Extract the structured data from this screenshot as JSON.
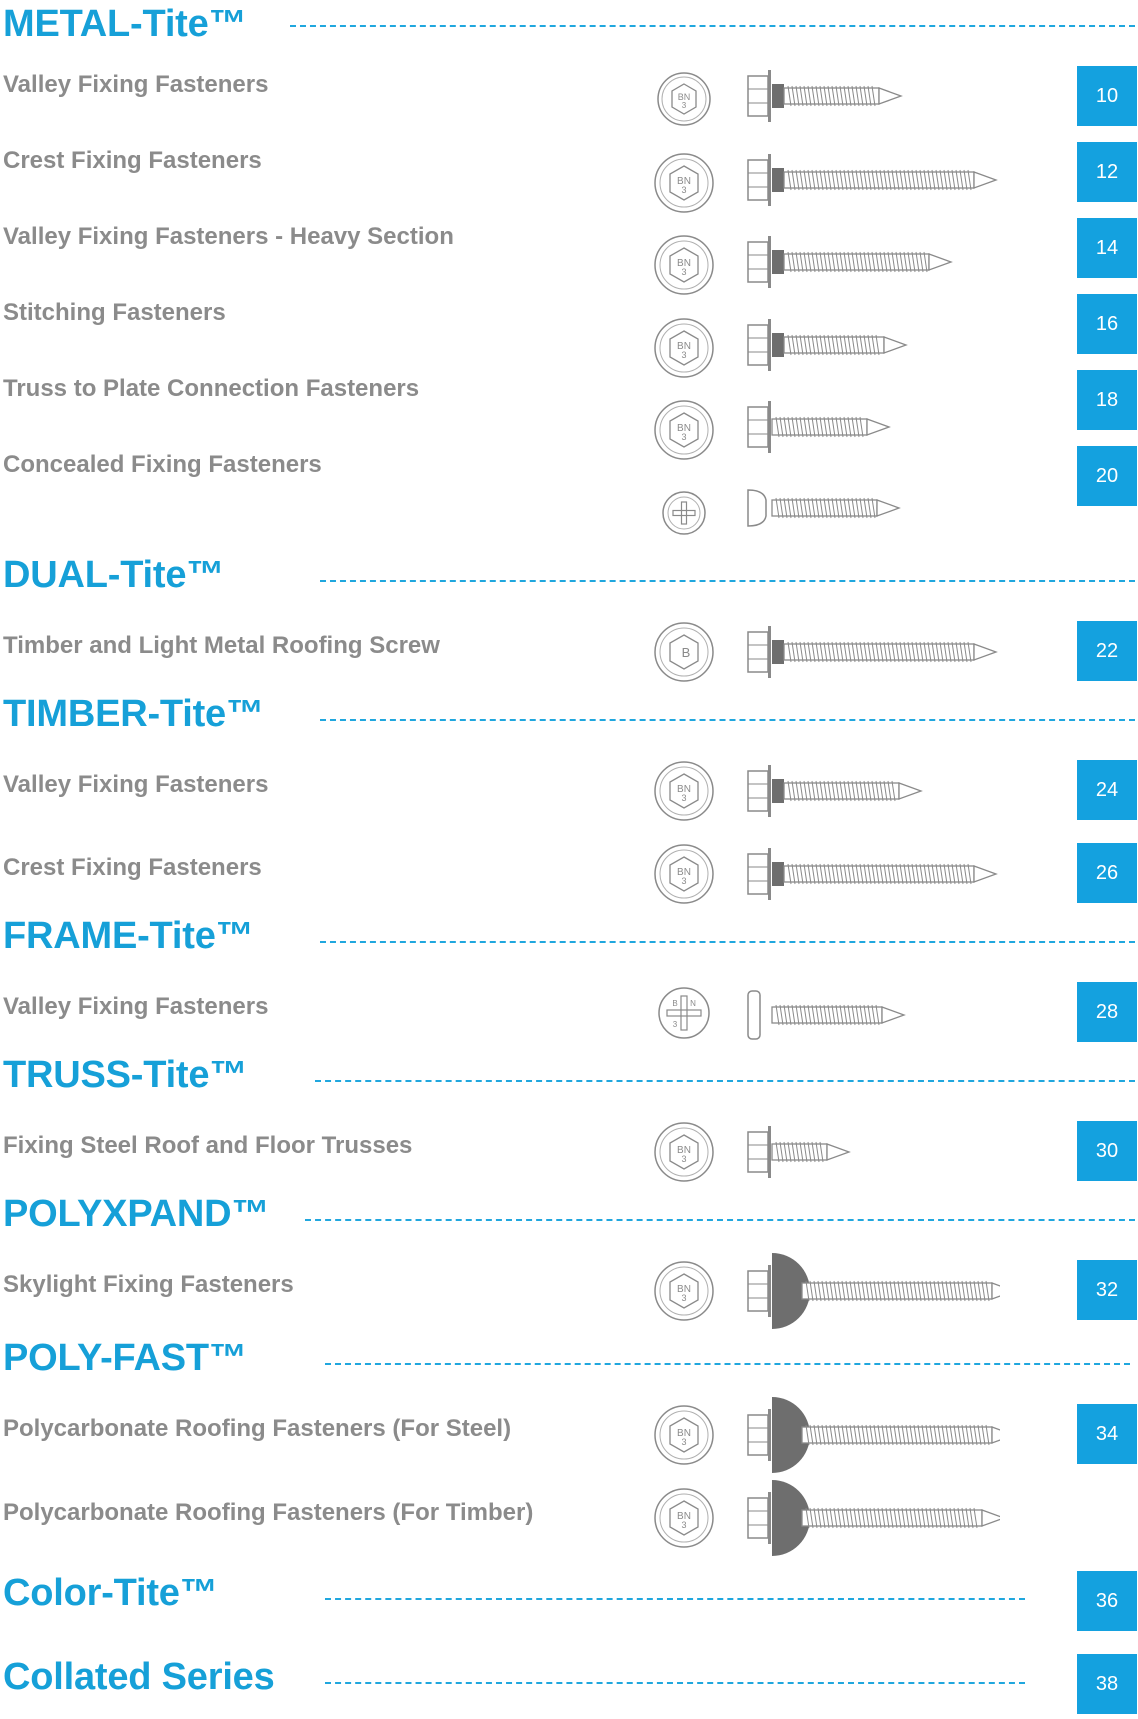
{
  "sections": [
    {
      "title": "METAL-Tite™",
      "items": [
        {
          "label": "Valley Fixing Fasteners",
          "page": "10",
          "head_icon": "hex-bn3-icon",
          "screw_icon": "self-drilling-screw-icon"
        },
        {
          "label": "Crest Fixing Fasteners",
          "page": "12",
          "head_icon": "hex-bn3-icon",
          "screw_icon": "long-self-drilling-screw-icon"
        },
        {
          "label": "Valley Fixing Fasteners - Heavy Section",
          "page": "14",
          "head_icon": "hex-bn3-icon",
          "screw_icon": "heavy-section-screw-icon"
        },
        {
          "label": "Stitching Fasteners",
          "page": "16",
          "head_icon": "hex-bn3-icon",
          "screw_icon": "stitching-screw-icon"
        },
        {
          "label": "Truss to Plate Connection Fasteners",
          "page": "18",
          "head_icon": "hex-bn3-icon",
          "screw_icon": "truss-plate-screw-icon"
        },
        {
          "label": "Concealed Fixing Fasteners",
          "page": "20",
          "head_icon": "phillips-head-icon",
          "screw_icon": "wafer-head-screw-icon"
        }
      ]
    },
    {
      "title": "DUAL-Tite™",
      "items": [
        {
          "label": "Timber and Light Metal Roofing Screw",
          "page": "22",
          "head_icon": "hex-b-icon",
          "screw_icon": "dual-thread-screw-icon"
        }
      ]
    },
    {
      "title": "TIMBER-Tite™",
      "items": [
        {
          "label": "Valley Fixing Fasteners",
          "page": "24",
          "head_icon": "hex-bn3-icon",
          "screw_icon": "timber-screw-icon"
        },
        {
          "label": "Crest Fixing Fasteners",
          "page": "26",
          "head_icon": "hex-bn3-icon",
          "screw_icon": "long-timber-screw-icon"
        }
      ]
    },
    {
      "title": "FRAME-Tite™",
      "items": [
        {
          "label": "Valley Fixing Fasteners",
          "page": "28",
          "head_icon": "phillips-bn3-icon",
          "screw_icon": "pan-head-screw-icon"
        }
      ]
    },
    {
      "title": "TRUSS-Tite™",
      "items": [
        {
          "label": "Fixing Steel Roof and Floor Trusses",
          "page": "30",
          "head_icon": "hex-bn3-icon",
          "screw_icon": "short-truss-screw-icon"
        }
      ]
    },
    {
      "title": "POLYXPAND™",
      "items": [
        {
          "label": "Skylight Fixing Fasteners",
          "page": "32",
          "head_icon": "hex-bn3-icon",
          "screw_icon": "dome-washer-screw-icon"
        }
      ]
    },
    {
      "title": "POLY-FAST™",
      "items": [
        {
          "label": "Polycarbonate Roofing Fasteners (For Steel)",
          "page": "34",
          "head_icon": "hex-bn3-icon",
          "screw_icon": "poly-steel-screw-icon"
        },
        {
          "label": "Polycarbonate Roofing Fasteners (For Timber)",
          "page": "",
          "head_icon": "hex-bn3-icon",
          "screw_icon": "poly-timber-screw-icon"
        }
      ]
    },
    {
      "title": "Color-Tite™",
      "page": "36",
      "items": []
    },
    {
      "title": "Collated Series",
      "page": "38",
      "items": []
    }
  ],
  "head_marks": {
    "bn": "BN",
    "three": "3",
    "b": "B"
  },
  "colors": {
    "accent": "#16a0d8",
    "badge": "#14a1df",
    "label": "#8b8b8b",
    "line_art": "#8a8a8a",
    "washer": "#6e6e6e"
  }
}
